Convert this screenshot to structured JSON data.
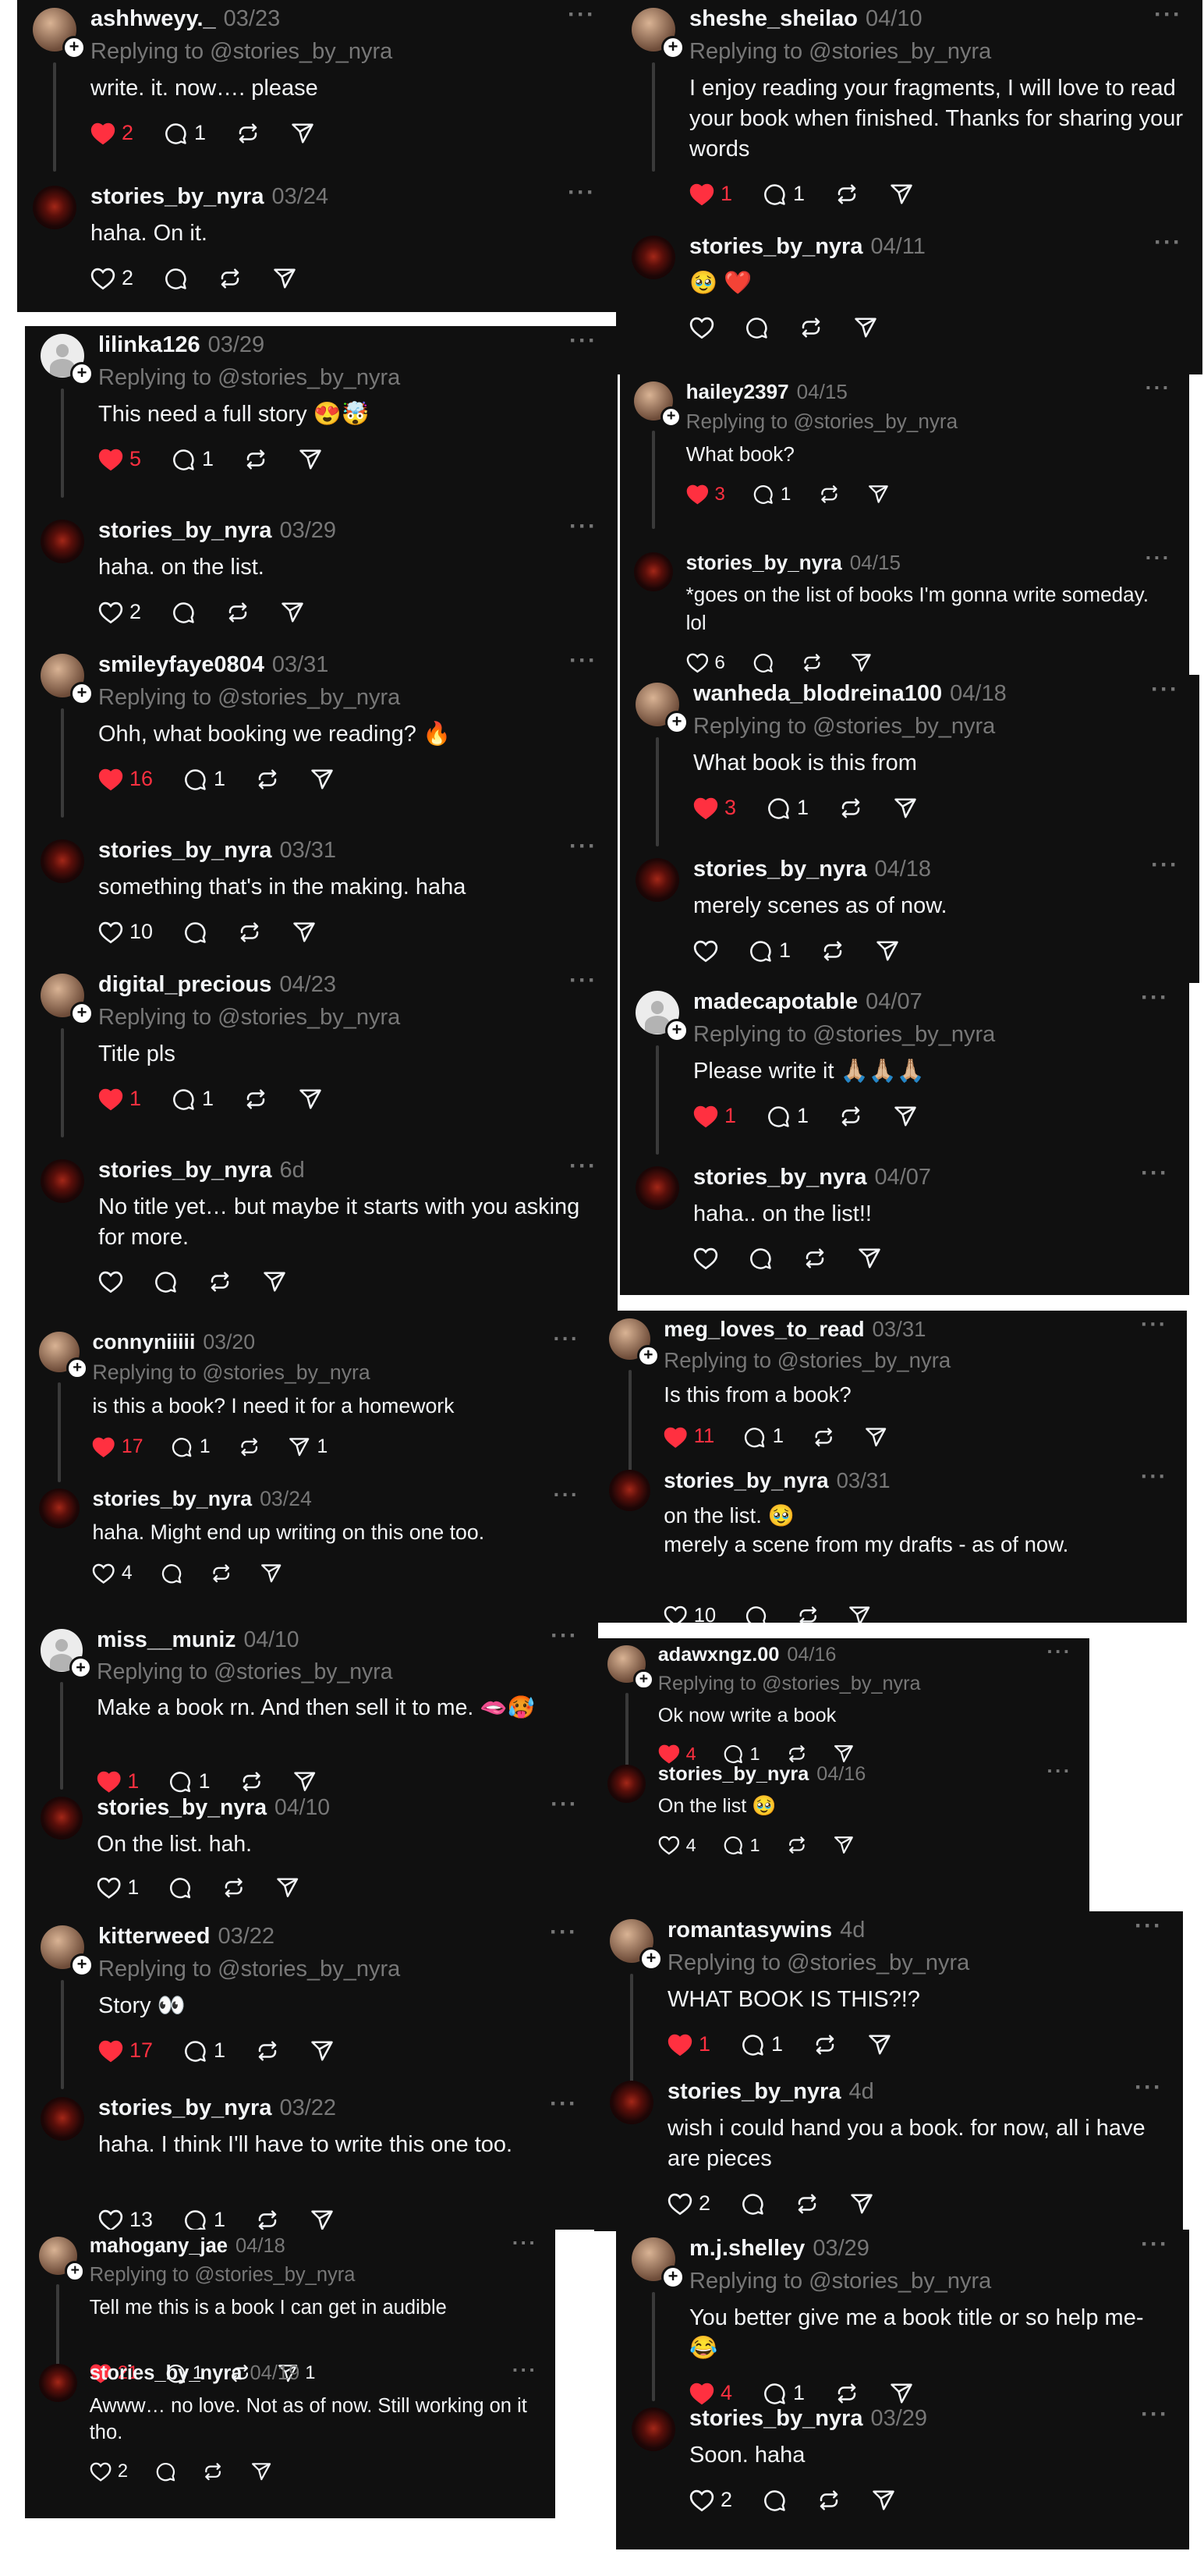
{
  "reply_prefix": "Replying to",
  "more_label": "···",
  "colors": {
    "background": "#101010",
    "liked": "#ff3040",
    "muted": "#777777",
    "text": "#f3f5f7"
  },
  "icons": {
    "like": "heart-icon",
    "comment": "comment-icon",
    "repost": "repost-icon",
    "share": "share-icon",
    "follow": "plus-icon",
    "more": "more-icon"
  },
  "threads": [
    {
      "comment": {
        "username": "ashhweyy._",
        "date": "03/23",
        "replying_to": "@stories_by_nyra",
        "text": "write. it. now…. please",
        "likes": "2",
        "liked": true,
        "replies": "1",
        "reposts": "",
        "shares": ""
      },
      "reply": {
        "username": "stories_by_nyra",
        "date": "03/24",
        "text": "haha. On it.",
        "likes": "2",
        "liked": false,
        "replies": "",
        "reposts": "",
        "shares": ""
      }
    },
    {
      "comment": {
        "username": "sheshe_sheilao",
        "date": "04/10",
        "replying_to": "@stories_by_nyra",
        "text": "I enjoy reading your fragments, I will love to read your book when finished. Thanks for sharing your words",
        "likes": "1",
        "liked": true,
        "replies": "1",
        "reposts": "",
        "shares": ""
      },
      "reply": {
        "username": "stories_by_nyra",
        "date": "04/11",
        "text": "🥹 ❤️",
        "likes": "",
        "liked": false,
        "replies": "",
        "reposts": "",
        "shares": ""
      }
    },
    {
      "comment": {
        "username": "lilinka126",
        "date": "03/29",
        "replying_to": "@stories_by_nyra",
        "text": "This need a full story 😍🤯",
        "likes": "5",
        "liked": true,
        "replies": "1",
        "reposts": "",
        "shares": ""
      },
      "reply": {
        "username": "stories_by_nyra",
        "date": "03/29",
        "text": "haha. on the list.",
        "likes": "2",
        "liked": false,
        "replies": "",
        "reposts": "",
        "shares": ""
      }
    },
    {
      "comment": {
        "username": "hailey2397",
        "date": "04/15",
        "replying_to": "@stories_by_nyra",
        "text": "What book?",
        "likes": "3",
        "liked": true,
        "replies": "1",
        "reposts": "",
        "shares": ""
      },
      "reply": {
        "username": "stories_by_nyra",
        "date": "04/15",
        "text": "*goes on the list of books I'm gonna write someday. lol",
        "likes": "6",
        "liked": false,
        "replies": "",
        "reposts": "",
        "shares": ""
      }
    },
    {
      "comment": {
        "username": "smileyfaye0804",
        "date": "03/31",
        "replying_to": "@stories_by_nyra",
        "text": "Ohh, what booking we reading? 🔥",
        "likes": "16",
        "liked": true,
        "replies": "1",
        "reposts": "",
        "shares": ""
      },
      "reply": {
        "username": "stories_by_nyra",
        "date": "03/31",
        "text": "something that's in the making. haha",
        "likes": "10",
        "liked": false,
        "replies": "",
        "reposts": "",
        "shares": ""
      }
    },
    {
      "comment": {
        "username": "wanheda_blodreina100",
        "date": "04/18",
        "replying_to": "@stories_by_nyra",
        "text": "What book is this from",
        "likes": "3",
        "liked": true,
        "replies": "1",
        "reposts": "",
        "shares": ""
      },
      "reply": {
        "username": "stories_by_nyra",
        "date": "04/18",
        "text": "merely scenes as of now.",
        "likes": "",
        "liked": false,
        "replies": "1",
        "reposts": "",
        "shares": ""
      }
    },
    {
      "comment": {
        "username": "digital_precious",
        "date": "04/23",
        "replying_to": "@stories_by_nyra",
        "text": "Title pls",
        "likes": "1",
        "liked": true,
        "replies": "1",
        "reposts": "",
        "shares": ""
      },
      "reply": {
        "username": "stories_by_nyra",
        "date": "6d",
        "text": "No title yet… but maybe it starts with you asking for more.",
        "likes": "",
        "liked": false,
        "replies": "",
        "reposts": "",
        "shares": ""
      }
    },
    {
      "comment": {
        "username": "madecapotable",
        "date": "04/07",
        "replying_to": "@stories_by_nyra",
        "text": "Please write it 🙏🏼🙏🏼🙏🏼",
        "likes": "1",
        "liked": true,
        "replies": "1",
        "reposts": "",
        "shares": ""
      },
      "reply": {
        "username": "stories_by_nyra",
        "date": "04/07",
        "text": "haha.. on the list!!",
        "likes": "",
        "liked": false,
        "replies": "",
        "reposts": "",
        "shares": ""
      }
    },
    {
      "comment": {
        "username": "connyniiiii",
        "date": "03/20",
        "replying_to": "@stories_by_nyra",
        "text": "is this a book? I need it for a homework",
        "likes": "17",
        "liked": true,
        "replies": "1",
        "reposts": "",
        "shares": "1"
      },
      "reply": {
        "username": "stories_by_nyra",
        "date": "03/24",
        "text": "haha. Might end up writing on this one too.",
        "likes": "4",
        "liked": false,
        "replies": "",
        "reposts": "",
        "shares": ""
      }
    },
    {
      "comment": {
        "username": "meg_loves_to_read",
        "date": "03/31",
        "replying_to": "@stories_by_nyra",
        "text": "Is this from a book?",
        "likes": "11",
        "liked": true,
        "replies": "1",
        "reposts": "",
        "shares": ""
      },
      "reply": {
        "username": "stories_by_nyra",
        "date": "03/31",
        "text": "on the list. 🥹\nmerely a scene from my drafts - as of now.",
        "likes": "10",
        "liked": false,
        "replies": "",
        "reposts": "",
        "shares": ""
      }
    },
    {
      "comment": {
        "username": "miss__muniz",
        "date": "04/10",
        "replying_to": "@stories_by_nyra",
        "text": "Make a book rn. And then sell it to me. 🫦🥵",
        "likes": "1",
        "liked": true,
        "replies": "1",
        "reposts": "",
        "shares": ""
      },
      "reply": {
        "username": "stories_by_nyra",
        "date": "04/10",
        "text": "On the list. hah.",
        "likes": "1",
        "liked": false,
        "replies": "",
        "reposts": "",
        "shares": ""
      }
    },
    {
      "comment": {
        "username": "adawxngz.00",
        "date": "04/16",
        "replying_to": "@stories_by_nyra",
        "text": "Ok now write a book",
        "likes": "4",
        "liked": true,
        "replies": "1",
        "reposts": "",
        "shares": ""
      },
      "reply": {
        "username": "stories_by_nyra",
        "date": "04/16",
        "text": "On the list 🥹",
        "likes": "4",
        "liked": false,
        "replies": "1",
        "reposts": "",
        "shares": ""
      }
    },
    {
      "comment": {
        "username": "kitterweed",
        "date": "03/22",
        "replying_to": "@stories_by_nyra",
        "text": "Story 👀",
        "likes": "17",
        "liked": true,
        "replies": "1",
        "reposts": "",
        "shares": ""
      },
      "reply": {
        "username": "stories_by_nyra",
        "date": "03/22",
        "text": "haha. I think I'll have to write this one too.",
        "likes": "13",
        "liked": false,
        "replies": "1",
        "reposts": "",
        "shares": ""
      }
    },
    {
      "comment": {
        "username": "romantasywins",
        "date": "4d",
        "replying_to": "@stories_by_nyra",
        "text": "WHAT BOOK IS THIS?!?",
        "likes": "1",
        "liked": true,
        "replies": "1",
        "reposts": "",
        "shares": ""
      },
      "reply": {
        "username": "stories_by_nyra",
        "date": "4d",
        "text": "wish i could hand you a book. for now, all i have are pieces",
        "likes": "2",
        "liked": false,
        "replies": "",
        "reposts": "",
        "shares": ""
      }
    },
    {
      "comment": {
        "username": "mahogany_jae",
        "date": "04/18",
        "replying_to": "@stories_by_nyra",
        "text": "Tell me this is a book I can get in audible",
        "likes": "21",
        "liked": true,
        "replies": "1",
        "reposts": "",
        "shares": "1"
      },
      "reply": {
        "username": "stories_by_nyra",
        "date": "04/19",
        "text": "Awww… no love. Not as of now. Still working on it tho.",
        "likes": "2",
        "liked": false,
        "replies": "",
        "reposts": "",
        "shares": ""
      }
    },
    {
      "comment": {
        "username": "m.j.shelley",
        "date": "03/29",
        "replying_to": "@stories_by_nyra",
        "text": "You better give me a book title or so help me- 😂",
        "likes": "4",
        "liked": true,
        "replies": "1",
        "reposts": "",
        "shares": ""
      },
      "reply": {
        "username": "stories_by_nyra",
        "date": "03/29",
        "text": "Soon. haha",
        "likes": "2",
        "liked": false,
        "replies": "",
        "reposts": "",
        "shares": ""
      }
    }
  ]
}
